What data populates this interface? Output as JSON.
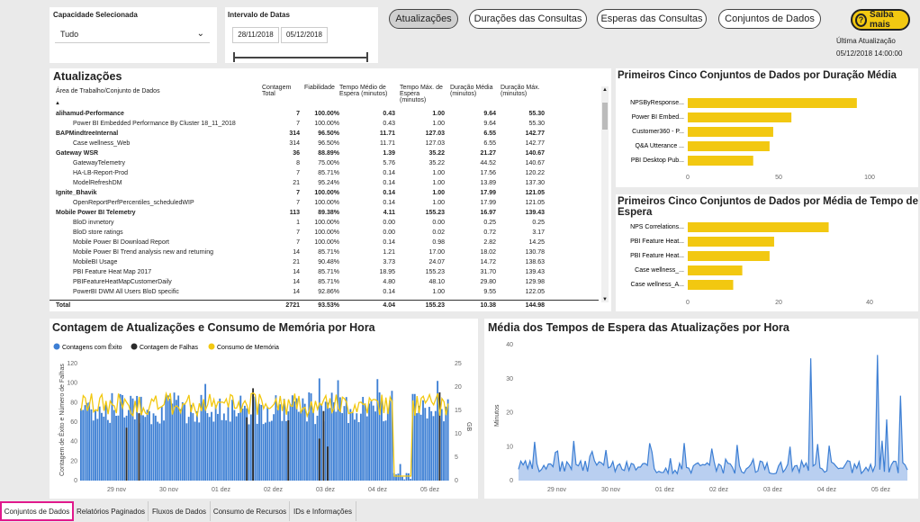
{
  "filters": {
    "capacity_label": "Capacidade Selecionada",
    "capacity_value": "Tudo",
    "date_label": "Intervalo de Datas",
    "date_start": "28/11/2018",
    "date_end": "05/12/2018"
  },
  "nav_buttons": [
    "Atualizações",
    "Durações das Consultas",
    "Esperas das Consultas",
    "Conjuntos de Dados"
  ],
  "help_button": "Saiba mais",
  "last_update": {
    "label": "Última Atualização",
    "value": "05/12/2018 14:00:00"
  },
  "table": {
    "title": "Atualizações",
    "headers": [
      "Área de Trabalho/Conjunto de Dados",
      "Contagem Total",
      "Fiabilidade",
      "Tempo Médio de Espera (minutos)",
      "Tempo Máx. de Espera (minutos)",
      "Duração Média (minutos)",
      "Duração Máx. (minutos)"
    ],
    "rows": [
      {
        "b": true,
        "c": [
          "alihamud-Performance",
          "7",
          "100.00%",
          "0.43",
          "1.00",
          "9.64",
          "55.30"
        ]
      },
      {
        "b": false,
        "c": [
          "Power BI Embedded Performance By Cluster 18_11_2018",
          "7",
          "100.00%",
          "0.43",
          "1.00",
          "9.64",
          "55.30"
        ]
      },
      {
        "b": true,
        "c": [
          "BAPMindtreeInternal",
          "314",
          "96.50%",
          "11.71",
          "127.03",
          "6.55",
          "142.77"
        ]
      },
      {
        "b": false,
        "c": [
          "Case wellness_Web",
          "314",
          "96.50%",
          "11.71",
          "127.03",
          "6.55",
          "142.77"
        ]
      },
      {
        "b": true,
        "c": [
          "Gateway WSR",
          "36",
          "88.89%",
          "1.39",
          "35.22",
          "21.27",
          "140.67"
        ]
      },
      {
        "b": false,
        "c": [
          "GatewayTelemetry",
          "8",
          "75.00%",
          "5.76",
          "35.22",
          "44.52",
          "140.67"
        ]
      },
      {
        "b": false,
        "c": [
          "HA-LB-Report-Prod",
          "7",
          "85.71%",
          "0.14",
          "1.00",
          "17.56",
          "120.22"
        ]
      },
      {
        "b": false,
        "c": [
          "ModelRefreshDM",
          "21",
          "95.24%",
          "0.14",
          "1.00",
          "13.89",
          "137.30"
        ]
      },
      {
        "b": true,
        "c": [
          "Ignite_Bhavik",
          "7",
          "100.00%",
          "0.14",
          "1.00",
          "17.99",
          "121.05"
        ]
      },
      {
        "b": false,
        "c": [
          "OpenReportPerfPercentiles_scheduledWIP",
          "7",
          "100.00%",
          "0.14",
          "1.00",
          "17.99",
          "121.05"
        ]
      },
      {
        "b": true,
        "c": [
          "Mobile Power BI Telemetry",
          "113",
          "89.38%",
          "4.11",
          "155.23",
          "16.97",
          "139.43"
        ]
      },
      {
        "b": false,
        "c": [
          "BloD invnetory",
          "1",
          "100.00%",
          "0.00",
          "0.00",
          "0.25",
          "0.25"
        ]
      },
      {
        "b": false,
        "c": [
          "BloD store ratings",
          "7",
          "100.00%",
          "0.00",
          "0.02",
          "0.72",
          "3.17"
        ]
      },
      {
        "b": false,
        "c": [
          "Mobile Power BI Download Report",
          "7",
          "100.00%",
          "0.14",
          "0.98",
          "2.82",
          "14.25"
        ]
      },
      {
        "b": false,
        "c": [
          "Mobile Power BI Trend analysis new and returning",
          "14",
          "85.71%",
          "1.21",
          "17.00",
          "18.02",
          "130.78"
        ]
      },
      {
        "b": false,
        "c": [
          "MobileBI Usage",
          "21",
          "90.48%",
          "3.73",
          "24.07",
          "14.72",
          "138.63"
        ]
      },
      {
        "b": false,
        "c": [
          "PBI Feature Heat Map 2017",
          "14",
          "85.71%",
          "18.95",
          "155.23",
          "31.70",
          "139.43"
        ]
      },
      {
        "b": false,
        "c": [
          "PBIFeatureHeatMapCustomerDaily",
          "14",
          "85.71%",
          "4.80",
          "48.10",
          "29.80",
          "129.98"
        ]
      },
      {
        "b": false,
        "c": [
          "PowerBI DWM All Users BloD specific",
          "14",
          "92.86%",
          "0.14",
          "1.00",
          "9.55",
          "122.05"
        ]
      }
    ],
    "total": [
      "Total",
      "2721",
      "93.53%",
      "4.04",
      "155.23",
      "10.38",
      "144.98"
    ]
  },
  "chart1": {
    "title": "Primeiros Cinco Conjuntos de Dados por Duração Média",
    "categories": [
      "NPSByResponse...",
      "Power BI Embed...",
      "Customer360 - P...",
      "Q&A Utterance ...",
      "PBI Desktop Pub..."
    ],
    "values": [
      93,
      57,
      47,
      45,
      36
    ],
    "ticks": [
      "0",
      "50",
      "100"
    ]
  },
  "chart2": {
    "title": "Primeiros Cinco Conjuntos de Dados por Média de Tempo de Espera",
    "categories": [
      "NPS Correlations...",
      "PBI Feature Heat...",
      "PBI Feature Heat...",
      "Case wellness_...",
      "Case wellness_A..."
    ],
    "values": [
      31,
      19,
      18,
      12,
      10
    ],
    "ticks": [
      "0",
      "20",
      "40"
    ]
  },
  "chart3": {
    "title": "Contagem de Atualizações e Consumo de Memória por Hora",
    "legend": [
      "Contagens com Êxito",
      "Contagem de Falhas",
      "Consumo de Memória"
    ],
    "y_left": [
      "0",
      "20",
      "40",
      "60",
      "80",
      "100",
      "120"
    ],
    "y_right": [
      "0",
      "5",
      "10",
      "15",
      "20",
      "25"
    ],
    "y_left_label": "Contagem de Êxito e Número de Falhas",
    "y_right_label": "GB",
    "x": [
      "29 nov",
      "30 nov",
      "01 dez",
      "02 dez",
      "03 dez",
      "04 dez",
      "05 dez"
    ],
    "colors": {
      "success": "#3d7fd4",
      "fail": "#2b2b2b",
      "memory": "#f2c811"
    }
  },
  "chart4": {
    "title": "Média dos Tempos de Espera das Atualizações por Hora",
    "y": [
      "0",
      "10",
      "20",
      "30",
      "40"
    ],
    "y_label": "Minutos",
    "x": [
      "29 nov",
      "30 nov",
      "01 dez",
      "02 dez",
      "03 dez",
      "04 dez",
      "05 dez"
    ],
    "color": "#3d7fd4"
  },
  "tabs": [
    "Conjuntos de Dados",
    "Relatórios Paginados",
    "Fluxos de Dados",
    "Consumo de Recursos",
    "IDs e Informações"
  ]
}
